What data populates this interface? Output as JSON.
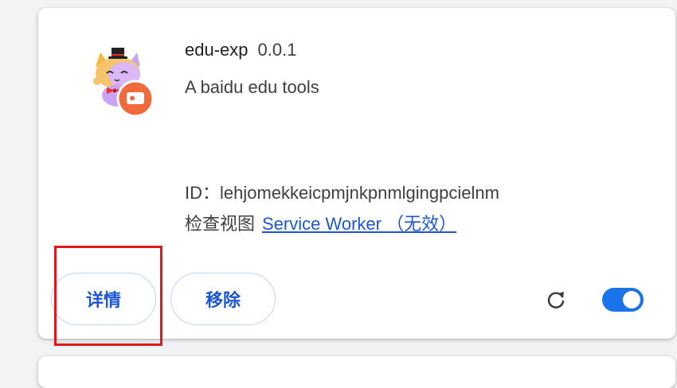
{
  "extension": {
    "icon": "cat-mascot-with-video-badge-icon",
    "name": "edu-exp",
    "version": "0.0.1",
    "description": "A baidu edu tools",
    "id_label": "ID：",
    "id_value": "lehjomekkeicpmjnkpnmlgingpcielnm",
    "inspect_label": "检查视图",
    "service_worker_link": "Service Worker （无效）"
  },
  "actions": {
    "details_label": "详情",
    "remove_label": "移除",
    "reload_icon": "reload-icon",
    "enabled": true
  },
  "colors": {
    "accent": "#1a73e8",
    "link": "#1a56d6",
    "highlight": "#e0161b"
  }
}
